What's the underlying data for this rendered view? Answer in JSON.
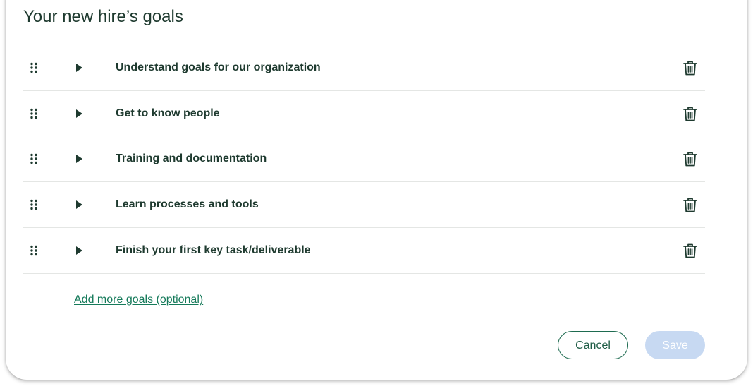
{
  "title": "Your new hire’s goals",
  "goals": [
    {
      "label": "Understand goals for our organization"
    },
    {
      "label": "Get to know people"
    },
    {
      "label": "Training and documentation"
    },
    {
      "label": "Learn processes and tools"
    },
    {
      "label": "Finish your first key task/deliverable"
    }
  ],
  "add_goals_link": "Add more goals (optional)",
  "buttons": {
    "cancel": "Cancel",
    "save": "Save",
    "save_state": "disabled"
  },
  "icons": {
    "drag": "drag-handle-icon",
    "expand": "caret-right-icon",
    "delete": "trash-icon"
  },
  "colors": {
    "text": "#1e3a2f",
    "link": "#157a5a",
    "cancel_border": "#1e6b50",
    "save_disabled_bg": "#c7d9f2",
    "divider": "#e4e6e4"
  }
}
